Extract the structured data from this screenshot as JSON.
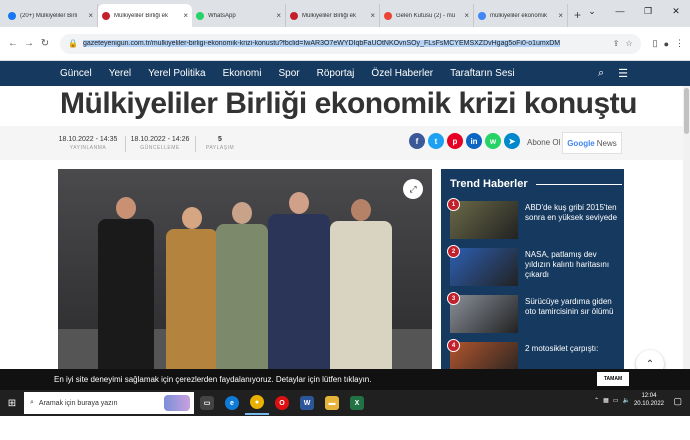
{
  "browser": {
    "tabs": [
      {
        "label": "(20+) Mülkiyeliler Birli",
        "favicon": "facebook-icon",
        "color": "#1877f2"
      },
      {
        "label": "Mülkiyeliler Birliği ek",
        "favicon": "y-icon",
        "color": "#c3202b",
        "active": true
      },
      {
        "label": "WhatsApp",
        "favicon": "whatsapp-icon",
        "color": "#25d366"
      },
      {
        "label": "Mülkiyeliler Birliği ek",
        "favicon": "y-icon",
        "color": "#c3202b"
      },
      {
        "label": "Gelen Kutusu (2) - mü",
        "favicon": "gmail-icon",
        "color": "#ea4335"
      },
      {
        "label": "mülkiyeliler ekonomik",
        "favicon": "google-icon",
        "color": "#4285f4"
      }
    ],
    "new_tab": "+",
    "close_glyph": "×",
    "url_highlight": "gazeteyenigun.com.tr/mulkiyeliler-birligi-ekonomik-krizi-konustu?fbclid=IwAR3O7eWYDIqbFaUOtNKOvnSOy_FLsFsMCYEMSXZDvHgag5oFi0-o1umxDM"
  },
  "nav": {
    "items": [
      "Güncel",
      "Yerel",
      "Yerel Politika",
      "Ekonomi",
      "Spor",
      "Röportaj",
      "Özel Haberler",
      "Taraftarın Sesi"
    ],
    "color": "#163a5f"
  },
  "article": {
    "title": "Mülkiyeliler Birliği ekonomik krizi konuştu",
    "published": {
      "value": "18.10.2022 - 14:35",
      "label": "YAYINLANMA"
    },
    "updated": {
      "value": "18.10.2022 - 14:26",
      "label": "GÜNCELLEME"
    },
    "shares": {
      "value": "5",
      "label": "PAYLAŞIM"
    },
    "follow_text": "Abone Ol",
    "google_news": {
      "g": "Google",
      "rest": "News"
    }
  },
  "share_buttons": [
    {
      "name": "facebook-share-button",
      "glyph": "f",
      "color": "#3b5998"
    },
    {
      "name": "twitter-share-button",
      "glyph": "t",
      "color": "#1da1f2"
    },
    {
      "name": "pinterest-share-button",
      "glyph": "p",
      "color": "#e60023"
    },
    {
      "name": "linkedin-share-button",
      "glyph": "in",
      "color": "#0a66c2"
    },
    {
      "name": "whatsapp-share-button",
      "glyph": "w",
      "color": "#25d366"
    },
    {
      "name": "telegram-share-button",
      "glyph": "➤",
      "color": "#0088cc"
    }
  ],
  "trend": {
    "heading": "Trend Haberler",
    "items": [
      {
        "num": "1",
        "title": "ABD'de kuş gribi 2015'ten sonra en yüksek seviyede",
        "color": "#6b6a48"
      },
      {
        "num": "2",
        "title": "NASA, patlamış dev yıldızın kalıntı haritasını çıkardı",
        "color": "#2c5fb3"
      },
      {
        "num": "3",
        "title": "Sürücüye yardıma giden oto tamircisinin sır ölümü",
        "color": "#8a9099"
      },
      {
        "num": "4",
        "title": "2 motosiklet çarpıştı:",
        "color": "#b2552d"
      }
    ]
  },
  "cookie": {
    "text": "En iyi site deneyimi sağlamak için çerezlerden faydalanıyoruz. Detaylar için lütfen tıklayın.",
    "button": "TAMAM"
  },
  "taskbar": {
    "search_placeholder": "Aramak için buraya yazın",
    "time": "12:04",
    "date": "20.10.2022"
  }
}
